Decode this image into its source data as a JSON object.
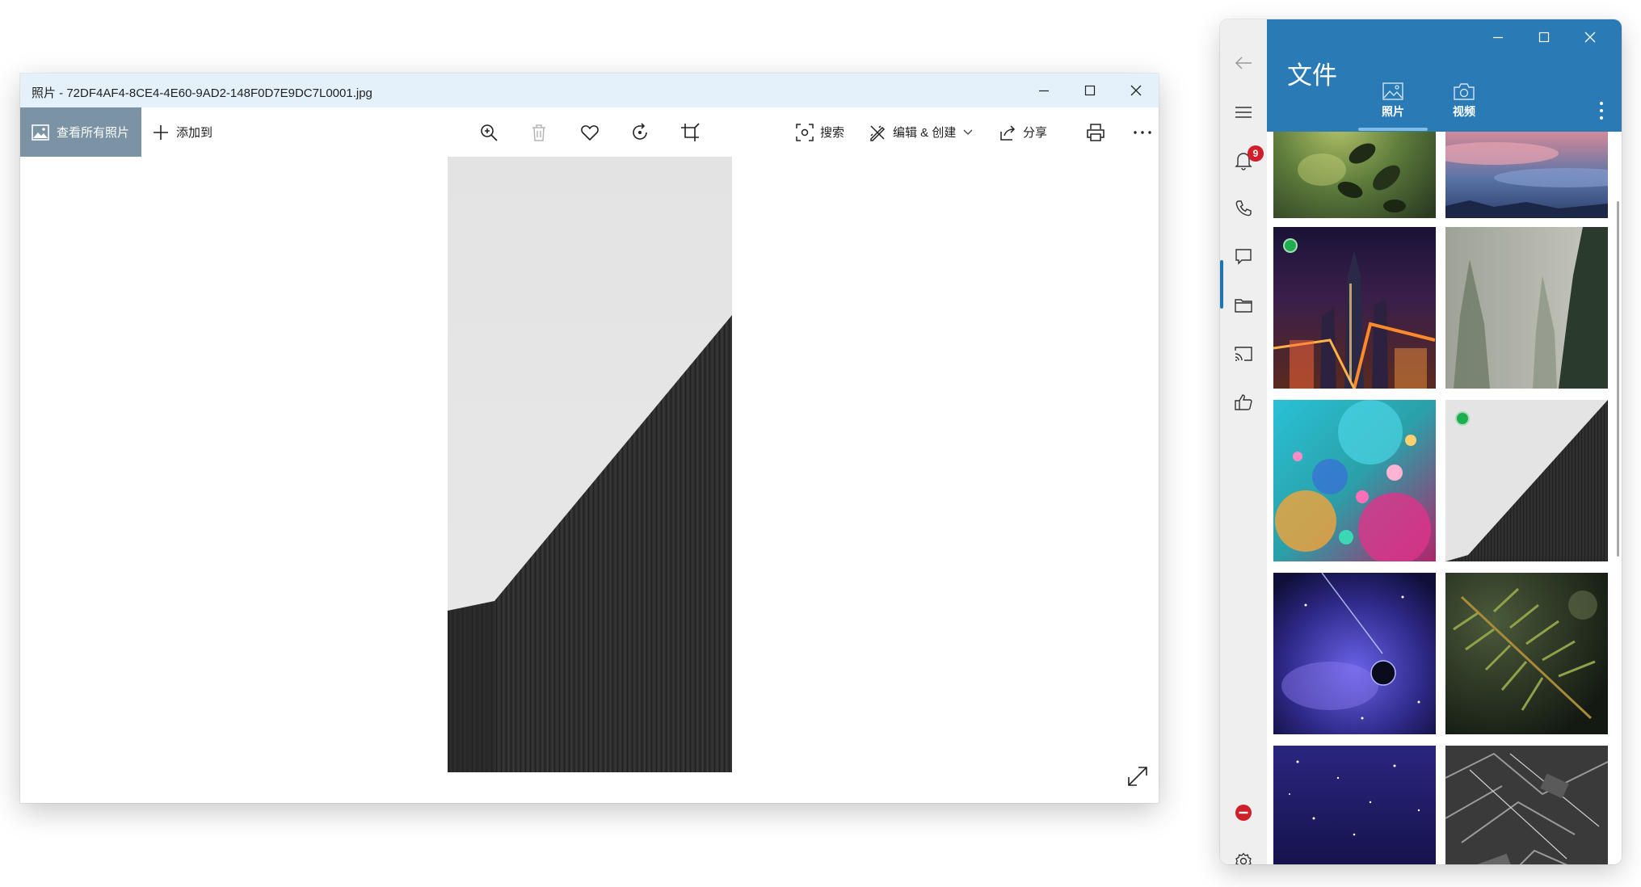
{
  "photos_window": {
    "title": "照片 - 72DF4AF4-8CE4-4E60-9AD2-148F0D7E9DC7L0001.jpg",
    "toolbar": {
      "view_all_label": "查看所有照片",
      "add_to_label": "添加到",
      "search_label": "搜索",
      "edit_create_label": "编辑 & 创建",
      "share_label": "分享"
    },
    "icons": [
      "zoom-icon",
      "delete-icon",
      "heart-icon",
      "rotate-icon",
      "crop-icon",
      "visual-search-icon",
      "edit-icon",
      "share-icon",
      "print-icon",
      "more-icon",
      "expand-icon"
    ]
  },
  "phone_window": {
    "header_title": "文件",
    "tabs": [
      {
        "label": "照片",
        "icon": "image-icon",
        "selected": true
      },
      {
        "label": "视频",
        "icon": "camera-icon",
        "selected": false
      }
    ],
    "notification_count": "9",
    "rail_icons": [
      "back-arrow-icon",
      "hamburger-icon",
      "bell-icon",
      "phone-icon",
      "chat-icon",
      "folder-icon",
      "cast-icon",
      "thumbs-up-icon",
      "stop-icon",
      "settings-icon"
    ],
    "active_rail_item": "folder-icon",
    "accent_color": "#2a7ab5",
    "thumbnails": [
      {
        "name": "leaves-green"
      },
      {
        "name": "pink-clouds"
      },
      {
        "name": "city-night",
        "selected": true
      },
      {
        "name": "foggy-trees"
      },
      {
        "name": "colorful-coral"
      },
      {
        "name": "building-wall",
        "selected": true
      },
      {
        "name": "space-planet"
      },
      {
        "name": "fern-branch"
      },
      {
        "name": "starry-sky"
      },
      {
        "name": "circuit-lines"
      }
    ]
  }
}
